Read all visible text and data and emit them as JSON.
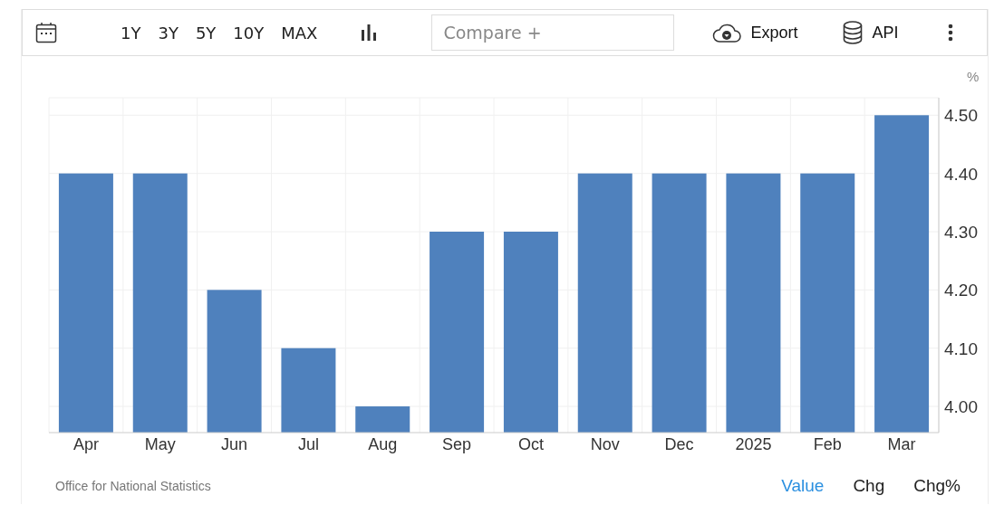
{
  "toolbar": {
    "ranges": [
      "1Y",
      "3Y",
      "5Y",
      "10Y",
      "MAX"
    ],
    "compare": {
      "placeholder": "Compare +"
    },
    "export": "Export",
    "api": "API"
  },
  "chart": {
    "unit": "%",
    "chart_data": {
      "type": "bar",
      "categories": [
        "Apr",
        "May",
        "Jun",
        "Jul",
        "Aug",
        "Sep",
        "Oct",
        "Nov",
        "Dec",
        "2025",
        "Feb",
        "Mar"
      ],
      "grid": true,
      "series": [
        {
          "color": "#4f81bd",
          "values": [
            4.4,
            4.4,
            4.2,
            4.1,
            4.0,
            4.3,
            4.3,
            4.4,
            4.4,
            4.4,
            4.4,
            4.5
          ]
        }
      ],
      "ylim": [
        3.955,
        4.53
      ],
      "yticks": [
        {
          "value": 4.0,
          "label": "4.00"
        },
        {
          "value": 4.1,
          "label": "4.10"
        },
        {
          "value": 4.2,
          "label": "4.20"
        },
        {
          "value": 4.3,
          "label": "4.30"
        },
        {
          "value": 4.4,
          "label": "4.40"
        },
        {
          "value": 4.5,
          "label": "4.50"
        }
      ]
    }
  },
  "footer": {
    "source": "Office for National Statistics",
    "modes": [
      {
        "label": "Value",
        "selected": true
      },
      {
        "label": "Chg",
        "selected": false
      },
      {
        "label": "Chg%",
        "selected": false
      }
    ]
  }
}
